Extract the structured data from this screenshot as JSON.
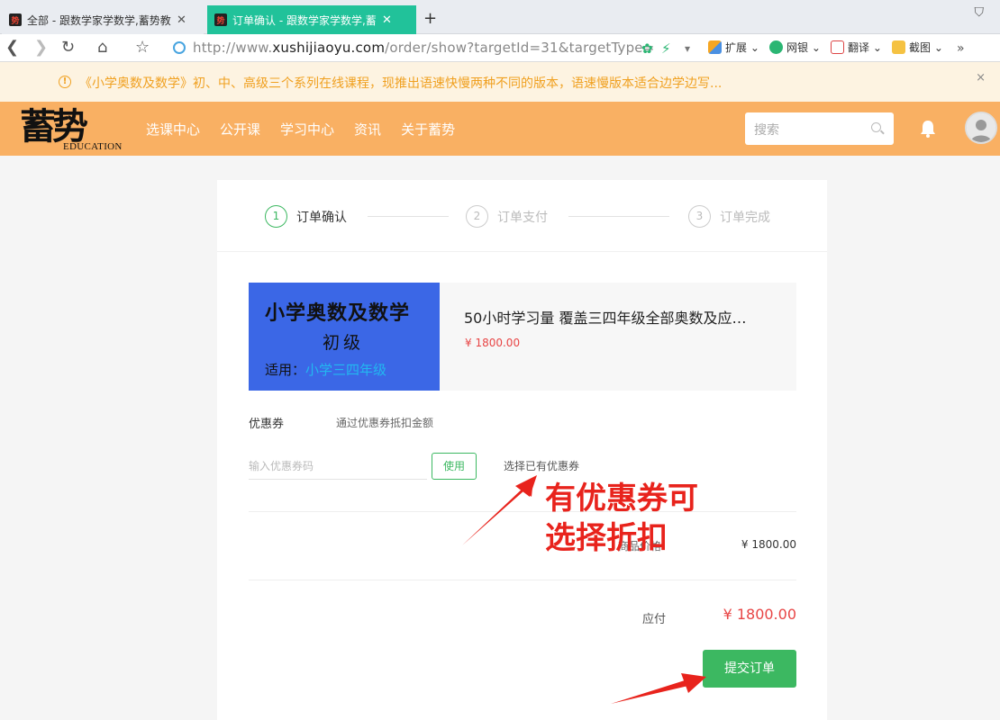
{
  "browser": {
    "tabs": [
      {
        "title": "全部 - 跟数学家学数学,蓄势教育",
        "active": false
      },
      {
        "title": "订单确认 - 跟数学家学数学,蓄势",
        "active": true
      }
    ],
    "url_prefix": "http://www.",
    "url_domain": "xushijiaoyu.com",
    "url_path": "/order/show?targetId=31&targetType=",
    "extensions": [
      "扩展",
      "网银",
      "翻译",
      "截图"
    ]
  },
  "notice": {
    "text": "《小学奥数及数学》初、中、高级三个系列在线课程，现推出语速快慢两种不同的版本，语速慢版本适合边学边写...",
    "close": "×"
  },
  "header": {
    "logo_cn": "蓄势",
    "logo_en": "EDUCATION",
    "menu": [
      "选课中心",
      "公开课",
      "学习中心",
      "资讯",
      "关于蓄势"
    ],
    "search_placeholder": "搜索"
  },
  "steps": [
    {
      "num": "1",
      "label": "订单确认",
      "active": true
    },
    {
      "num": "2",
      "label": "订单支付",
      "active": false
    },
    {
      "num": "3",
      "label": "订单完成",
      "active": false
    }
  ],
  "course": {
    "cover_title": "小学奥数及数学",
    "cover_level": "初级",
    "cover_for_label": "适用：",
    "cover_for_value": "小学三四年级",
    "name": "50小时学习量 覆盖三四年级全部奥数及应…",
    "price": "¥ 1800.00"
  },
  "coupon": {
    "label": "优惠券",
    "desc": "通过优惠券抵扣金额",
    "input_placeholder": "输入优惠券码",
    "use_button": "使用",
    "select_existing": "选择已有优惠券"
  },
  "summary": {
    "amount_label": "商品价格",
    "amount_value": "¥ 1800.00",
    "pay_label": "应付",
    "pay_value": "¥ 1800.00",
    "submit_button": "提交订单"
  },
  "annotation": {
    "line1": "有优惠券可",
    "line2": "选择折扣"
  },
  "colors": {
    "accent_green": "#3cb861",
    "header_orange": "#f9b063",
    "price_red": "#e84545",
    "annotation_red": "#e8231c"
  }
}
